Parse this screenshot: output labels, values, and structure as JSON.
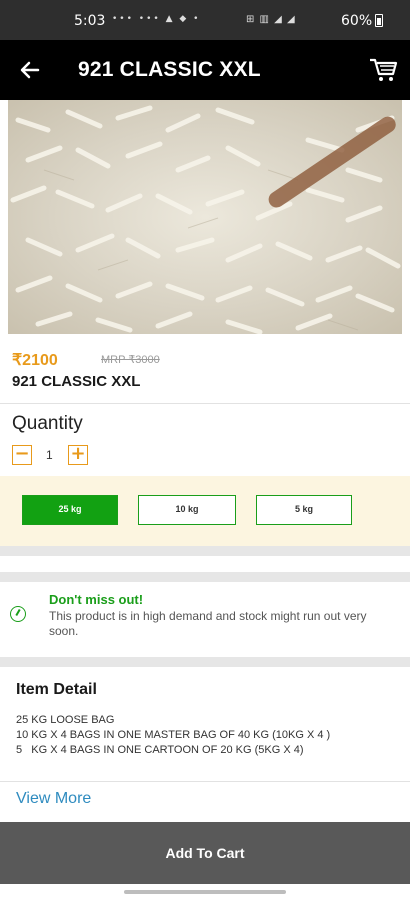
{
  "status_bar": {
    "time": "5:03",
    "notification_icons": "••• ••• ▲ ◆ •",
    "system_icons": "⊞ ▥ ◢ ◢",
    "battery": "60%"
  },
  "appbar": {
    "back_icon": "back-arrow-icon",
    "title": "921 CLASSIC XXL",
    "cart_icon": "cart-icon"
  },
  "product": {
    "image": "basmati rice grains",
    "price": "₹2100",
    "mrp": "MRP ₹3000",
    "name": "921 CLASSIC XXL"
  },
  "quantity": {
    "label": "Quantity",
    "minus": "−",
    "value": "1",
    "plus": "+"
  },
  "sizes": [
    {
      "label": "25 kg",
      "selected": true
    },
    {
      "label": "10 kg",
      "selected": false
    },
    {
      "label": "5 kg",
      "selected": false
    }
  ],
  "alert": {
    "title": "Don't miss out!",
    "text": "This product is in high demand and stock might run out very soon."
  },
  "item_detail": {
    "title": "Item Detail",
    "lines": "25 KG LOOSE BAG\n10 KG X 4 BAGS IN ONE MASTER BAG OF 40 KG (10KG X 4 )\n5   KG X 4 BAGS IN ONE CARTOON OF 20 KG (5KG X 4)"
  },
  "view_more": "View More",
  "add_to_cart": "Add To Cart",
  "colors": {
    "accent": "#e89a1b",
    "green": "#12a112",
    "link": "#2e8bbf",
    "appbar": "#000000",
    "cta": "#595959"
  }
}
